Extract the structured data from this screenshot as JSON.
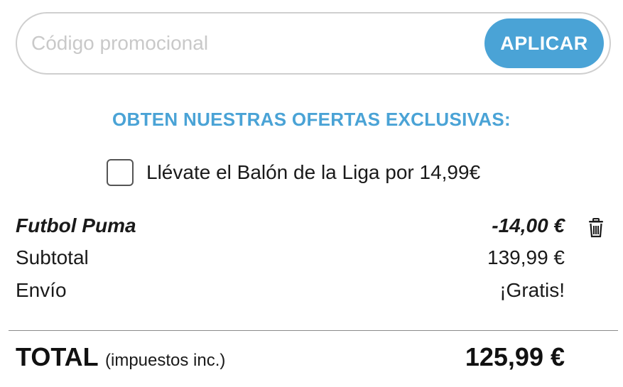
{
  "promo": {
    "placeholder": "Código promocional",
    "value": "",
    "apply_label": "APLICAR"
  },
  "offers": {
    "title": "OBTEN NUESTRAS OFERTAS EXCLUSIVAS:",
    "items": [
      {
        "label": "Llévate el Balón de la Liga por 14,99€",
        "checked": false
      }
    ]
  },
  "summary": {
    "discount": {
      "label": "Futbol Puma",
      "value": "-14,00 €",
      "icon": "trash-icon"
    },
    "subtotal": {
      "label": "Subtotal",
      "value": "139,99 €"
    },
    "shipping": {
      "label": "Envío",
      "value": "¡Gratis!"
    },
    "total": {
      "label": "TOTAL",
      "sublabel": "(impuestos inc.)",
      "value": "125,99 €"
    }
  },
  "colors": {
    "accent": "#4aa3d6",
    "text": "#1a1a1a",
    "border": "#cfcfcf"
  }
}
